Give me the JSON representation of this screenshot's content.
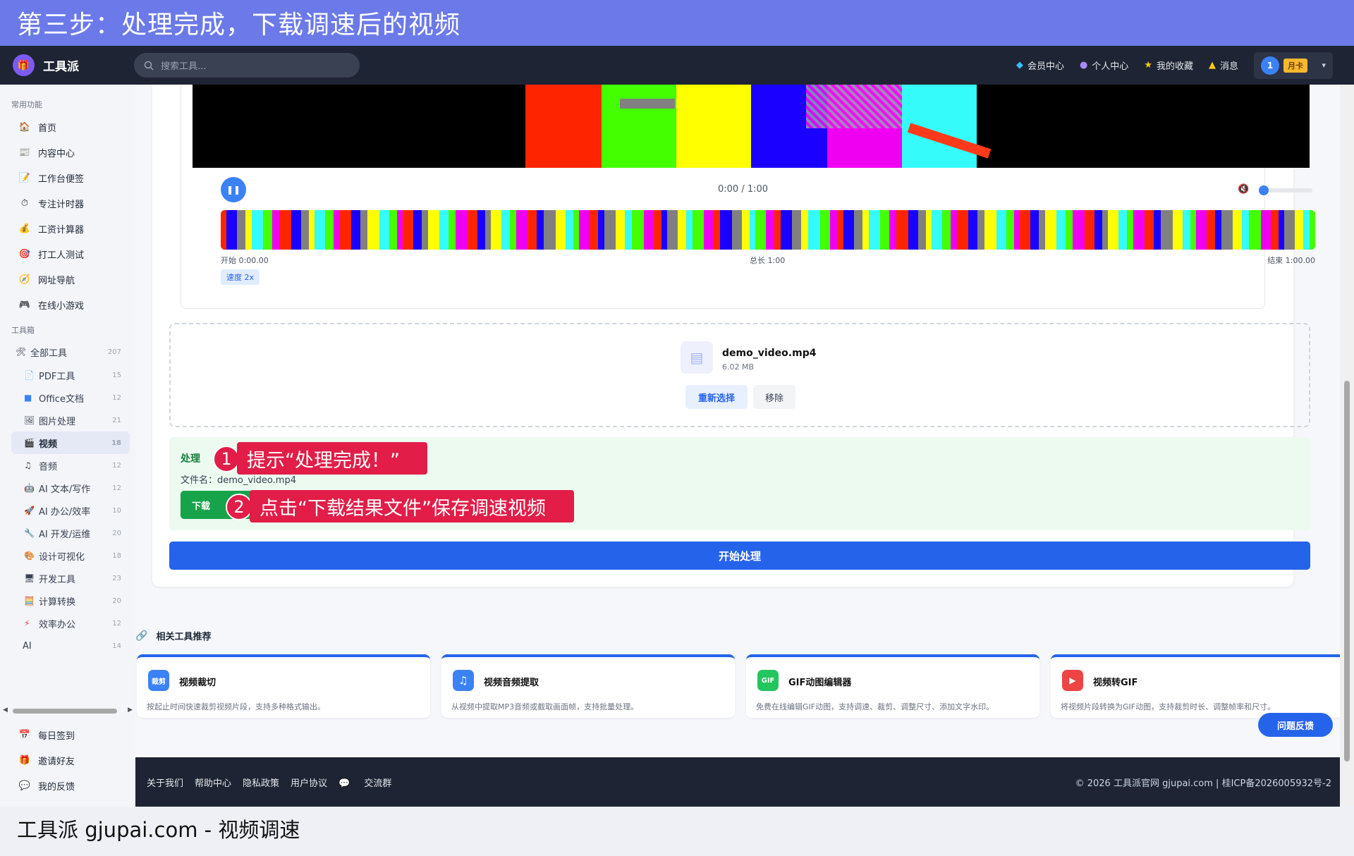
{
  "banner": {
    "title": "第三步：处理完成，下载调速后的视频"
  },
  "caption": {
    "text": "工具派 gjupai.com - 视频调速"
  },
  "topnav": {
    "logo_text": "工具派",
    "search_placeholder": "搜索工具...",
    "links": [
      {
        "label": "会员中心",
        "icon": "diamond-icon"
      },
      {
        "label": "个人中心",
        "icon": "user-icon"
      },
      {
        "label": "我的收藏",
        "icon": "star-icon"
      },
      {
        "label": "消息",
        "icon": "bell-icon"
      }
    ],
    "user": {
      "avatar": "1",
      "tag": "月卡"
    }
  },
  "sidebar": {
    "section_common": "常用功能",
    "common": [
      "首页",
      "内容中心",
      "工作台便签",
      "专注计时器",
      "工资计算器",
      "打工人测试",
      "网址导航",
      "在线小游戏"
    ],
    "section_tools": "工具箱",
    "all_tools": {
      "label": "全部工具",
      "count": "207"
    },
    "tools": [
      {
        "label": "PDF工具",
        "count": "15"
      },
      {
        "label": "Office文档",
        "count": "12"
      },
      {
        "label": "图片处理",
        "count": "21"
      },
      {
        "label": "视频",
        "count": "18"
      },
      {
        "label": "音频",
        "count": "12"
      },
      {
        "label": "AI 文本/写作",
        "count": "12"
      },
      {
        "label": "AI 办公/效率",
        "count": "10"
      },
      {
        "label": "AI 开发/运维",
        "count": "20"
      },
      {
        "label": "设计可视化",
        "count": "18"
      },
      {
        "label": "开发工具",
        "count": "23"
      },
      {
        "label": "计算转换",
        "count": "20"
      },
      {
        "label": "效率办公",
        "count": "12"
      },
      {
        "label": "AI",
        "count": "14"
      }
    ],
    "bottom": [
      "每日签到",
      "邀请好友",
      "我的反馈"
    ]
  },
  "player": {
    "time": "0:00 / 1:00",
    "start_label": "开始 0:00.00",
    "total_label": "总长 1:00",
    "end_label": "结束 1:00.00",
    "speed": "速度 2x"
  },
  "file": {
    "name": "demo_video.mp4",
    "size": "6.02 MB",
    "reselect": "重新选择",
    "remove": "移除"
  },
  "result": {
    "title": "处理",
    "filename": "文件名：demo_video.mp4",
    "download": "下载"
  },
  "start_button": "开始处理",
  "callouts": [
    {
      "num": "1",
      "text": "提示“处理完成！”"
    },
    {
      "num": "2",
      "text": "点击“下载结果文件”保存调速视频"
    }
  ],
  "related": {
    "title": "相关工具推荐",
    "cards": [
      {
        "name": "视频裁切",
        "desc": "按起止时间快速裁剪视频片段，支持多种格式输出。",
        "icon_label": "裁剪",
        "color": "#3b82f6"
      },
      {
        "name": "视频音频提取",
        "desc": "从视频中提取MP3音频或截取画面帧，支持批量处理。",
        "icon_label": "♫",
        "color": "#3b82f6"
      },
      {
        "name": "GIF动图编辑器",
        "desc": "免费在线编辑GIF动图，支持调速、裁剪、调整尺寸、添加文字水印。",
        "icon_label": "GIF",
        "color": "#22c55e"
      },
      {
        "name": "视频转GIF",
        "desc": "将视频片段转换为GIF动图，支持裁剪时长、调整帧率和尺寸。",
        "icon_label": "▶",
        "color": "#ef4444"
      }
    ]
  },
  "feedback": "问题反馈",
  "footer": {
    "links": [
      "关于我们",
      "帮助中心",
      "隐私政策",
      "用户协议",
      "交流群"
    ],
    "copyright": "© 2026 工具派官网 gjupai.com | 桂ICP备2026005932号-2"
  }
}
